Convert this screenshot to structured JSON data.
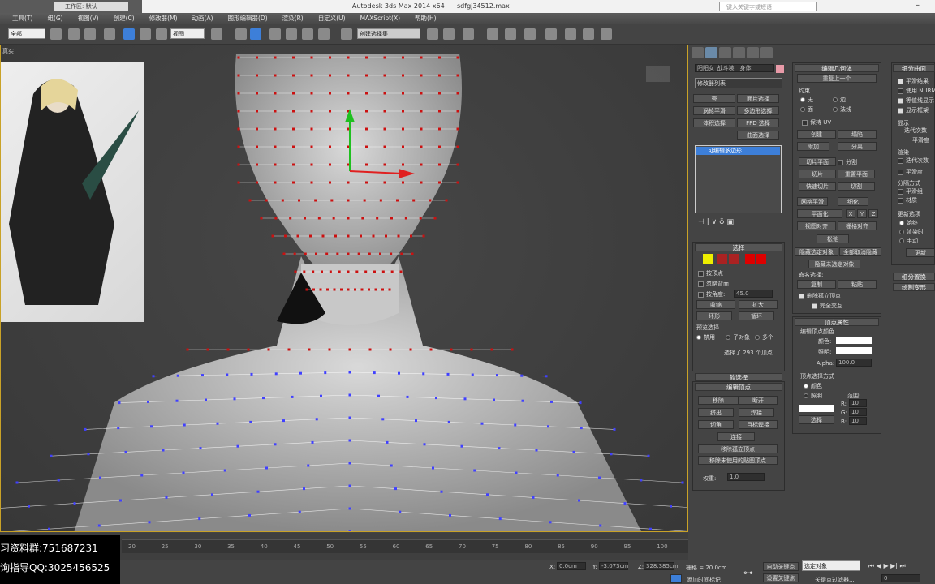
{
  "titlebar": {
    "app": "Autodesk 3ds Max  2014 x64",
    "file": "sdfgj34512.max",
    "workspace": "工作区: 默认",
    "search_placeholder": "键入关键字或短语"
  },
  "menu": [
    "工具(T)",
    "组(G)",
    "视图(V)",
    "创建(C)",
    "修改器(M)",
    "动画(A)",
    "图形编辑器(D)",
    "渲染(R)",
    "自定义(U)",
    "MAXScript(X)",
    "帮助(H)"
  ],
  "toolbar": {
    "selection_filter": "全部",
    "ref_coord": "视图",
    "named_sel": "创建选择集"
  },
  "viewport": {
    "label": "真实",
    "gizmo_colors": {
      "x": "#e02020",
      "y": "#20c020",
      "z": "#3060ff"
    },
    "selected_vertex_color": "#cc1010",
    "vertex_color": "#4040ff"
  },
  "modify": {
    "object_name": "阳阳女_战斗装__身体",
    "modifier_list": "修改器列表",
    "mod_buttons": [
      "壳",
      "面片选择",
      "涡轮平滑",
      "多边形选择",
      "体积选择",
      "FFD 选择",
      "",
      "曲面选择"
    ],
    "stack_item": "可编辑多边形"
  },
  "selection": {
    "title": "选择",
    "by_vertex": "按顶点",
    "ignore_backface": "忽略背面",
    "by_angle": "按角度:",
    "angle": "45.0",
    "shrink": "收缩",
    "grow": "扩大",
    "ring": "环形",
    "loop": "循环",
    "preview_title": "预览选择",
    "preview_opts": [
      "禁用",
      "子对象",
      "多个"
    ],
    "status": "选择了 293 个顶点"
  },
  "soft_sel": {
    "title": "软选择"
  },
  "edit_vertices": {
    "title": "编辑顶点",
    "buttons": [
      "移除",
      "断开",
      "挤出",
      "焊接",
      "切角",
      "目标焊接",
      "连接",
      "移除孤立顶点",
      "移除未使用的贴图顶点"
    ],
    "weight_label": "权重:",
    "weight": "1.0"
  },
  "edit_geometry": {
    "title": "编辑几何体",
    "repeat": "重复上一个",
    "constraints": "约束",
    "c_opts": [
      "无",
      "边",
      "面",
      "法线"
    ],
    "preserve_uv": "保持 UV",
    "create": "创建",
    "collapse": "塌陷",
    "attach": "附加",
    "detach": "分离",
    "slice_plane": "切片平面",
    "split": "分割",
    "slice": "切片",
    "reset_plane": "重置平面",
    "quickslice": "快速切片",
    "cut": "切割",
    "meshsmooth": "网格平滑",
    "tessellate": "细化",
    "make_planar": "平面化",
    "x": "X",
    "y": "Y",
    "z": "Z",
    "view_align": "视图对齐",
    "grid_align": "栅格对齐",
    "relax": "松弛",
    "hide_sel": "隐藏选定对象",
    "unhide_all": "全部取消隐藏",
    "hide_unsel": "隐藏未选定对象",
    "named_sel": "命名选择:",
    "copy": "复制",
    "paste": "粘贴",
    "delete_iso": "删除孤立顶点",
    "full_interact": "完全交互"
  },
  "vertex_props": {
    "title": "顶点属性",
    "edit_color": "编辑顶点颜色",
    "color": "颜色:",
    "illum": "照明:",
    "alpha_label": "Alpha:",
    "alpha": "100.0",
    "sel_by": "顶点选择方式",
    "sel_opts": [
      "颜色",
      "照明"
    ],
    "range": "范围:",
    "r": "10",
    "g": "10",
    "b": "10",
    "select": "选择"
  },
  "subdiv": {
    "title": "细分曲面",
    "items": [
      "平滑结果",
      "使用 NURMS 细分",
      "等值线显示",
      "显示框架"
    ],
    "display": "显示",
    "iter": "迭代次数",
    "smooth": "平滑度",
    "render": "渲染",
    "sep": "分隔方式",
    "sep_opts": [
      "平滑组",
      "材质"
    ],
    "update": "更新选项",
    "update_opts": [
      "始终",
      "渲染时",
      "手动"
    ],
    "update_btn": "更新",
    "collapsed": [
      "细分置换",
      "绘制变形"
    ]
  },
  "timeline": {
    "ticks": [
      "20",
      "25",
      "30",
      "35",
      "40",
      "45",
      "50",
      "55",
      "60",
      "65",
      "70",
      "75",
      "80",
      "85",
      "90",
      "95",
      "100"
    ]
  },
  "status": {
    "x": "0.0cm",
    "y": "-3.073cm",
    "z": "328.385cm",
    "grid": "栅格 = 20.0cm",
    "add_time_tag": "添加时间标记",
    "auto_key": "自动关键点",
    "set_key": "设置关键点",
    "key_mode": "选定对象",
    "key_filters": "关键点过滤器...",
    "frame": "0"
  },
  "watermark": [
    "习资料群:751687231",
    "询指导QQ:3025456525"
  ]
}
